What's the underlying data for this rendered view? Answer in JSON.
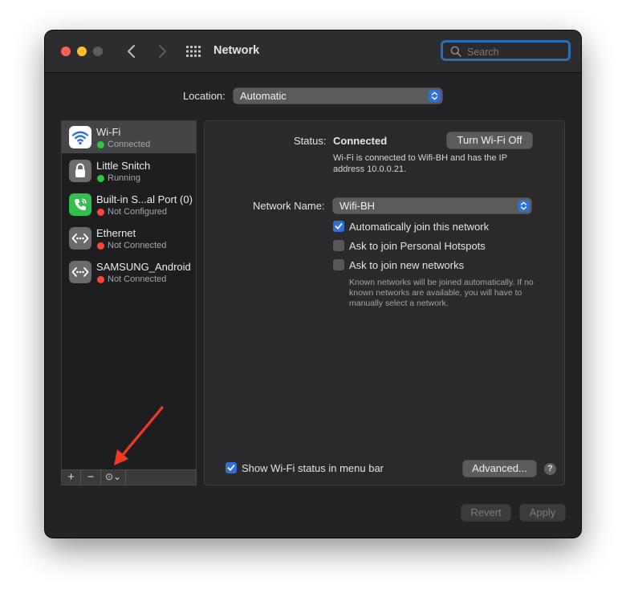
{
  "window": {
    "title": "Network",
    "search_placeholder": "Search"
  },
  "location": {
    "label": "Location:",
    "value": "Automatic"
  },
  "services": [
    {
      "name": "Wi-Fi",
      "status": "Connected",
      "status_color": "#28c840",
      "icon": "wifi-icon",
      "selected": true
    },
    {
      "name": "Little Snitch",
      "status": "Running",
      "status_color": "#28c840",
      "icon": "lock-icon"
    },
    {
      "name": "Built-in S...al Port (0)",
      "status": "Not Configured",
      "status_color": "#ff453a",
      "icon": "phone-icon"
    },
    {
      "name": "Ethernet",
      "status": "Not Connected",
      "status_color": "#ff453a",
      "icon": "ethernet-icon"
    },
    {
      "name": "SAMSUNG_Android",
      "status": "Not Connected",
      "status_color": "#ff453a",
      "icon": "ethernet-icon"
    }
  ],
  "sidebar_buttons": {
    "add": "+",
    "remove": "−",
    "action": "⊙⌄"
  },
  "detail": {
    "status_label": "Status:",
    "status_value": "Connected",
    "turn_off_button": "Turn Wi-Fi Off",
    "status_description_1": "Wi-Fi is connected to Wifi-BH and has the IP",
    "status_description_2": "address 10.0.0.21.",
    "network_name_label": "Network Name:",
    "network_name_value": "Wifi-BH",
    "auto_join": {
      "label": "Automatically join this network",
      "checked": true
    },
    "ask_hotspots": {
      "label": "Ask to join Personal Hotspots",
      "checked": false
    },
    "ask_new": {
      "label": "Ask to join new networks",
      "checked": false
    },
    "known_desc_1": "Known networks will be joined automatically. If no",
    "known_desc_2": "known networks are available, you will have to",
    "known_desc_3": "manually select a network.",
    "show_status": {
      "label": "Show Wi-Fi status in menu bar",
      "checked": true
    },
    "advanced_button": "Advanced...",
    "help_button": "?"
  },
  "footer": {
    "revert_button": "Revert",
    "apply_button": "Apply"
  },
  "colors": {
    "accent": "#2f6fd8",
    "annotation_arrow": "#f03a24"
  }
}
